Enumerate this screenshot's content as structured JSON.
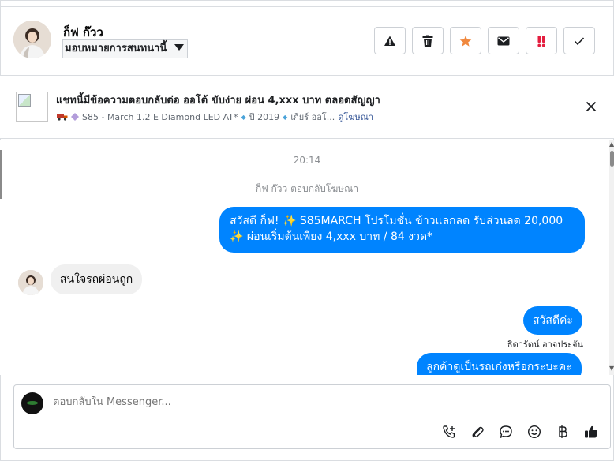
{
  "contact": {
    "name": "ก็ฟ ก๊วว",
    "assign_label": "มอบหมายการสนทนานี้"
  },
  "toolbar": {
    "icons": [
      "warning-icon",
      "trash-icon",
      "star-icon",
      "mail-icon",
      "spam-icon",
      "check-icon"
    ],
    "colors": {
      "star": "#f0883e",
      "spam": "#e41e3f"
    }
  },
  "ad": {
    "title": "แชทนี้มีข้อความตอบกลับต่อ ออโต้ ขับง่าย ผ่อน 4,xxx บาท ตลอดสัญญา",
    "model": "S85 - March 1.2 E Diamond LED AT*",
    "year": "ปี 2019",
    "gear": "เกียร์ ออโ...",
    "link": "ดูโฆษณา"
  },
  "thread": {
    "time": "20:14",
    "note": "ก็ฟ ก๊วว ตอบกลับโฆษณา",
    "messages": [
      {
        "direction": "out",
        "line1": "สวัสดี ก็ฟ! ✨ S85MARCH โปรโมชั่น ข้าวแลกลด รับส่วนลด 20,000",
        "line2": "✨ ผ่อนเริ่มต้นเพียง 4,xxx บาท / 84 งวด*"
      },
      {
        "direction": "in",
        "text": "สนใจรถผ่อนถูก"
      },
      {
        "direction": "out",
        "text": "สวัสดีค่ะ"
      },
      {
        "direction": "out",
        "text": "ลูกค้าดูเป็นรถเก๋งหรือกระบะคะ"
      }
    ],
    "sender": "ธิดารัตน์ อาจประจัน"
  },
  "composer": {
    "placeholder": "ตอบกลับใน Messenger...",
    "icons": [
      "call-add-icon",
      "attachment-icon",
      "saved-reply-icon",
      "emoji-icon",
      "baht-icon",
      "thumbs-up-icon"
    ]
  },
  "colors": {
    "bubble_out": "#0084ff",
    "bubble_in": "#f0f0f0"
  }
}
